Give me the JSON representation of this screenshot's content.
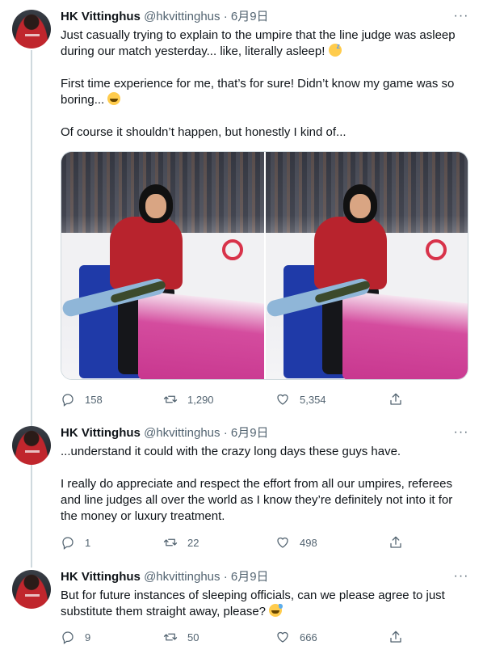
{
  "tweets": [
    {
      "author": {
        "name": "HK Vittinghus",
        "handle": "@hkvittinghus",
        "separator": "·",
        "date": "6月9日"
      },
      "more": "···",
      "lines": [
        "Just casually trying to explain to the umpire that the line judge was asleep",
        "during our match yesterday... like, literally asleep!",
        "First time experience for me, that’s for sure! Didn’t know my game was so",
        "boring...",
        "Of course it shouldn’t happen, but honestly I kind of..."
      ],
      "emojis": [
        "sleeping-face-emoji",
        "grinning-squinting-face-emoji"
      ],
      "stats": {
        "replies": "158",
        "retweets": "1,290",
        "likes": "5,354"
      }
    },
    {
      "author": {
        "name": "HK Vittinghus",
        "handle": "@hkvittinghus",
        "separator": "·",
        "date": "6月9日"
      },
      "more": "···",
      "lines": [
        "...understand it could with the crazy long days these guys have.",
        "I really do appreciate and respect the effort from all our umpires, referees",
        "and line judges all over the world as I know they’re definitely not into it for",
        "the money or luxury treatment."
      ],
      "stats": {
        "replies": "1",
        "retweets": "22",
        "likes": "498"
      }
    },
    {
      "author": {
        "name": "HK Vittinghus",
        "handle": "@hkvittinghus",
        "separator": "·",
        "date": "6月9日"
      },
      "more": "···",
      "lines": [
        "But for future instances of sleeping officials, can we please agree to just",
        "substitute them straight away, please?"
      ],
      "emojis": [
        "grinning-sweat-emoji"
      ],
      "stats": {
        "replies": "9",
        "retweets": "50",
        "likes": "666"
      }
    }
  ],
  "colors": {
    "text": "#0f1419",
    "secondary": "#536471",
    "thread_line": "#cfd9de",
    "background": "#ffffff"
  }
}
